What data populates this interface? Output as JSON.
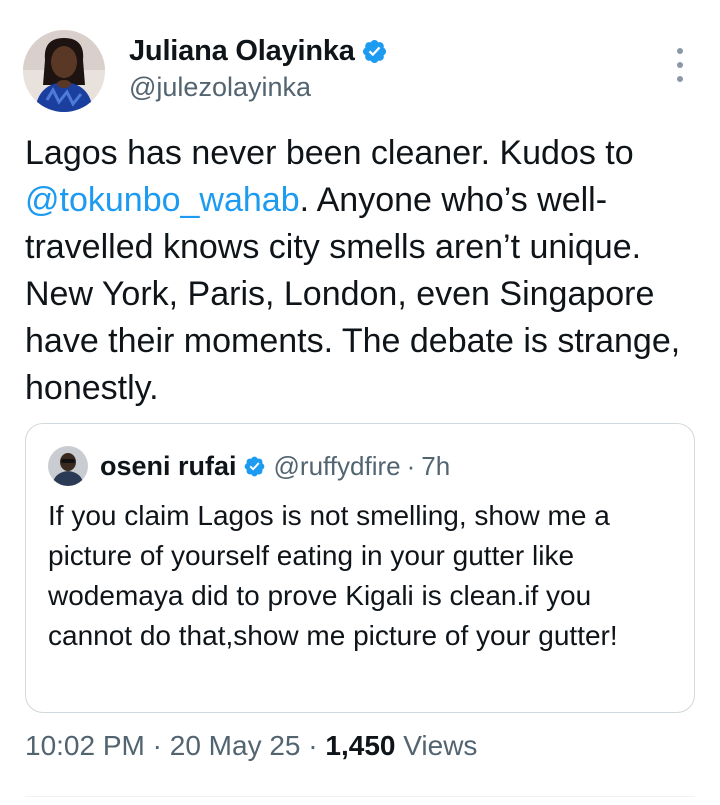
{
  "tweet": {
    "author": {
      "name": "Juliana Olayinka",
      "handle": "@julezolayinka"
    },
    "text_parts": {
      "line_start": "Lagos has never been cleaner. Kudos to ",
      "mention": "@tokunbo_wahab",
      "line_end": ". Anyone who’s well-travelled knows city smells aren’t unique. New York, Paris, London, even Singapore have their moments. The debate is strange, honestly."
    },
    "quote": {
      "name": "oseni rufai",
      "handle": "@ruffydfire",
      "separator": "·",
      "time": "7h",
      "text": "If you claim Lagos is not smelling, show me a picture of yourself  eating in your gutter like wodemaya did to prove Kigali is clean.if you cannot do that,show me picture of your gutter!"
    },
    "meta": {
      "time": "10:02 PM",
      "sep1": "·",
      "date": "20 May 25",
      "sep2": "·",
      "views_count": "1,450",
      "views_label": "Views"
    }
  },
  "colors": {
    "accent": "#1d9bf0",
    "text": "#0f1419",
    "secondary": "#536471",
    "border": "#cfd9de"
  },
  "icons": {
    "verified": "verified-badge-icon",
    "more": "more-options-icon"
  }
}
